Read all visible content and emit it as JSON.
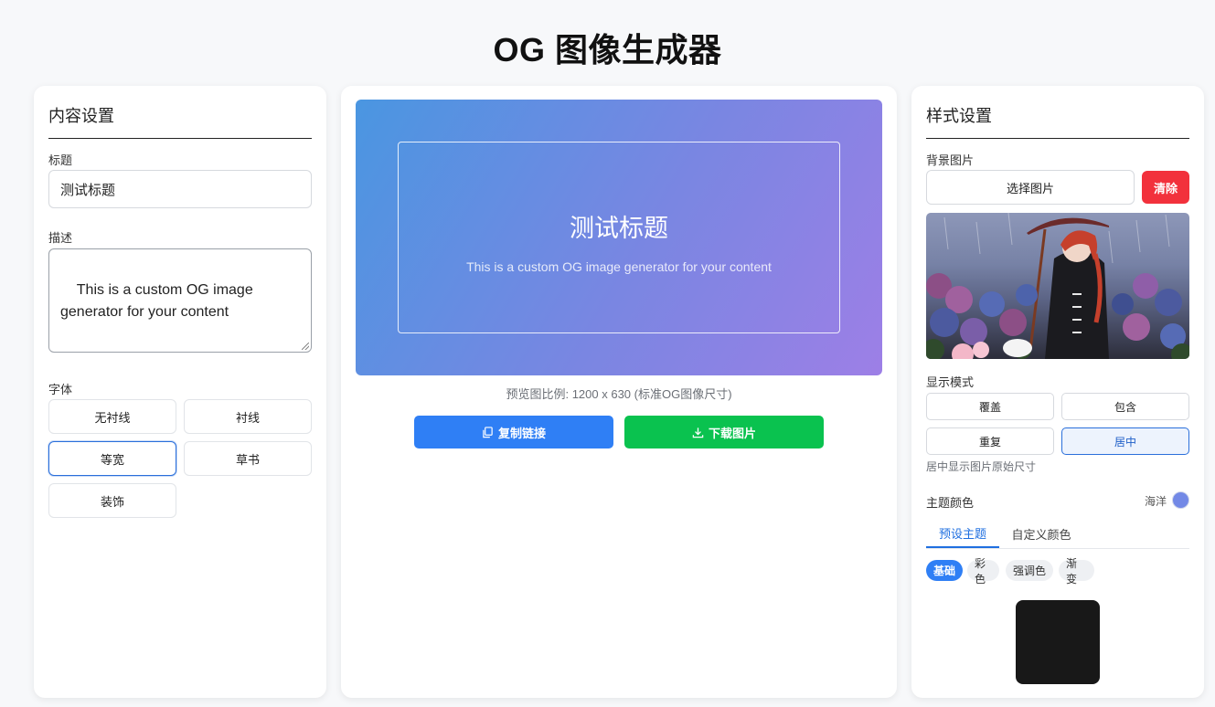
{
  "page": {
    "title": "OG 图像生成器"
  },
  "content_panel": {
    "heading": "内容设置",
    "title_label": "标题",
    "title_value": "测试标题",
    "desc_label": "描述",
    "desc_value": "This is a custom OG image\ngenerator for your content",
    "font_label": "字体",
    "font_options": [
      "无衬线",
      "衬线",
      "等宽",
      "草书",
      "装饰"
    ],
    "font_selected": "等宽"
  },
  "preview": {
    "title": "测试标题",
    "description": "This is a custom OG image generator for your content",
    "caption": "预览图比例: 1200 x 630 (标准OG图像尺寸)",
    "copy_label": "复制链接",
    "download_label": "下载图片",
    "gradient_colors": [
      "#4a96e1",
      "#9d7fe6"
    ]
  },
  "style_panel": {
    "heading": "样式设置",
    "bg_label": "背景图片",
    "select_label": "选择图片",
    "clear_label": "清除",
    "mode_label": "显示模式",
    "modes": [
      "覆盖",
      "包含",
      "重复",
      "居中"
    ],
    "mode_selected": "居中",
    "mode_hint": "居中显示图片原始尺寸",
    "theme_label": "主题颜色",
    "theme_name": "海洋",
    "theme_color": "#7389e6",
    "tabs": [
      "预设主题",
      "自定义颜色"
    ],
    "tab_active": "预设主题",
    "chips": [
      "基础",
      "彩色",
      "强调色",
      "渐变"
    ],
    "chip_active": "基础",
    "swatch_color": "#181818"
  }
}
